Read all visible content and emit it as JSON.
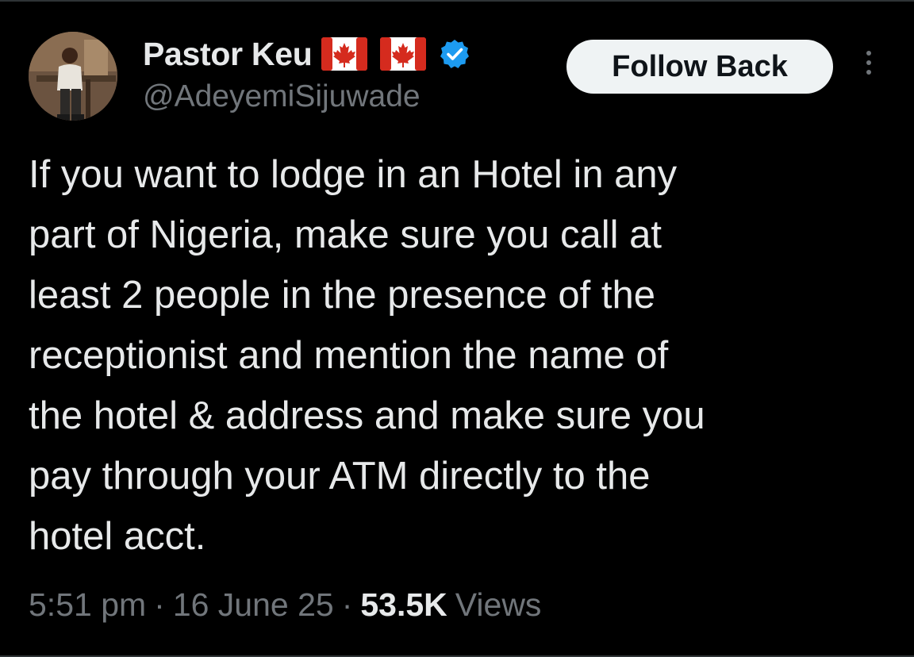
{
  "author": {
    "display_name": "Pastor Keu",
    "handle": "@AdeyemiSijuwade",
    "badges": [
      "canada-flag-icon",
      "canada-flag-icon",
      "verified-badge-icon"
    ],
    "verified_color": "#1d9bf0",
    "flag_red": "#d52b1e"
  },
  "actions": {
    "follow_label": "Follow Back",
    "more_icon": "more-vertical-icon"
  },
  "tweet": {
    "lines": [
      "If you want to lodge in an Hotel in any",
      "part of Nigeria, make sure you call at",
      "least 2 people in the presence of the",
      "receptionist and mention the name of",
      "the hotel & address and make sure you",
      "pay through your ATM directly to the",
      "hotel acct."
    ]
  },
  "meta": {
    "time": "5:51 pm",
    "separator": "·",
    "date": "16 June 25",
    "views_count": "53.5K",
    "views_label": "Views"
  },
  "colors": {
    "background": "#000000",
    "text": "#e7e9ea",
    "secondary": "#71767b",
    "button_bg": "#eff3f4"
  }
}
